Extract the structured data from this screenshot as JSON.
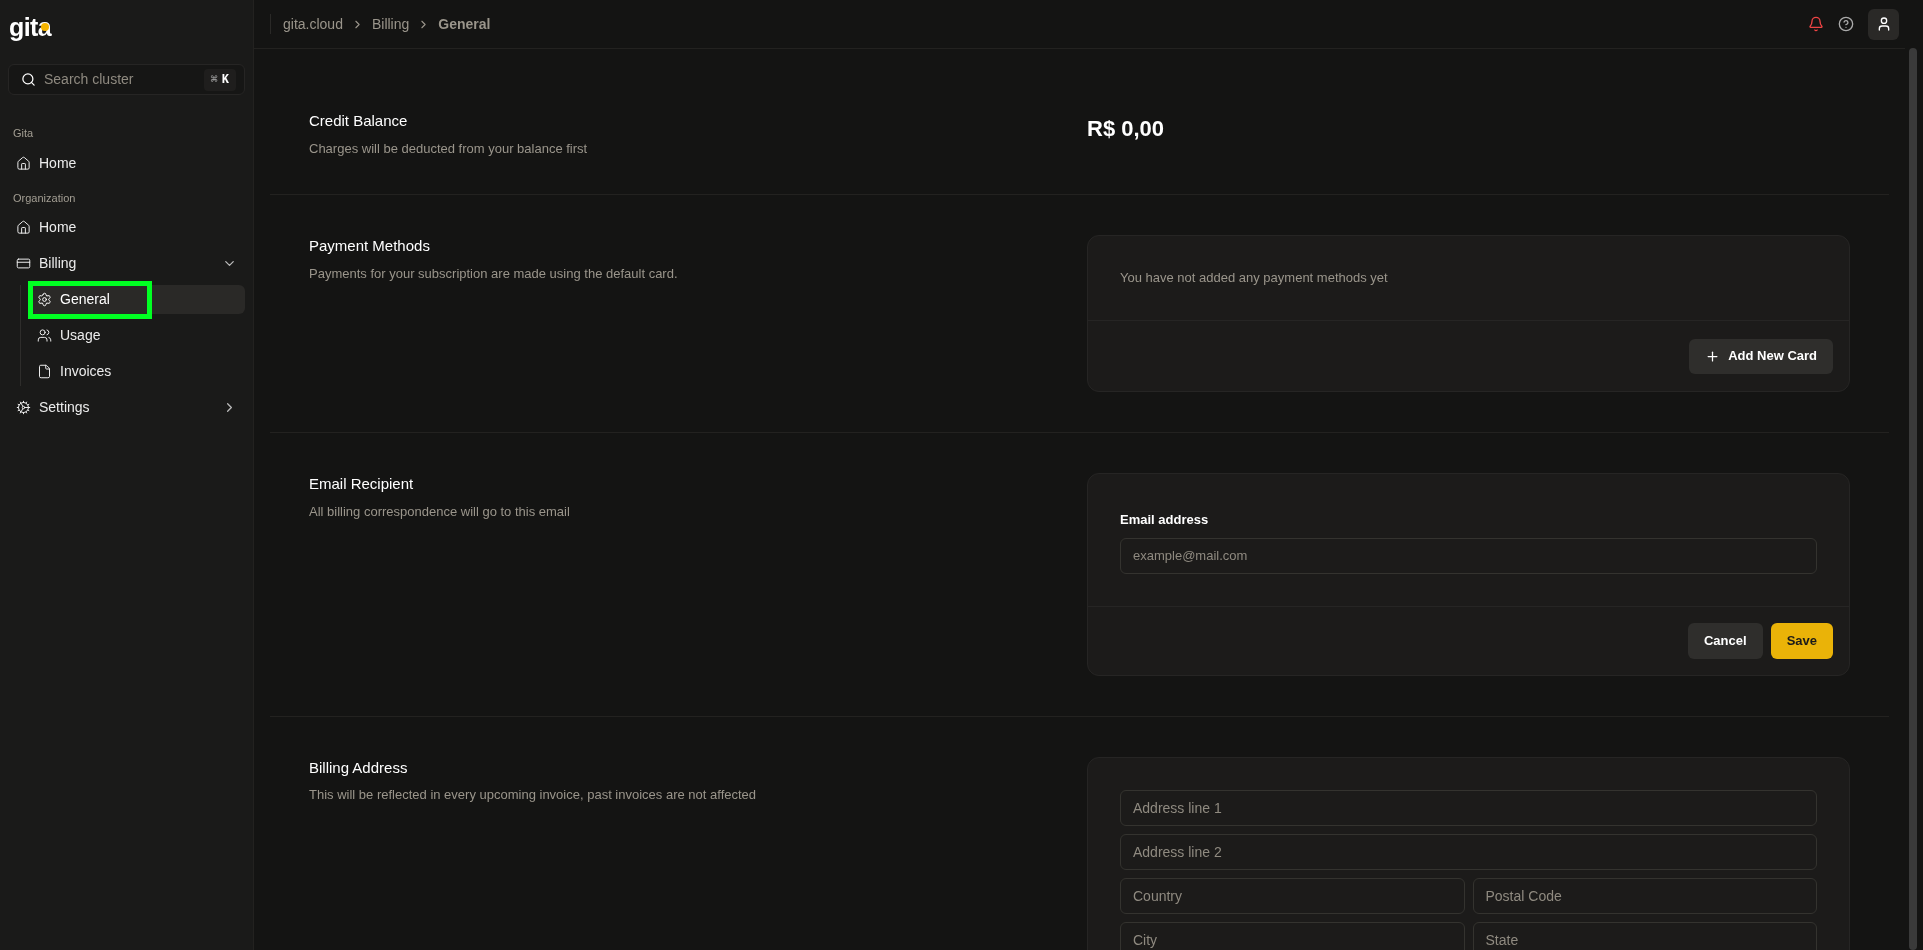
{
  "sidebar": {
    "logo": "gita",
    "search": {
      "placeholder": "Search cluster",
      "shortcut_symbol": "⌘",
      "shortcut_key": "K"
    },
    "groups": [
      {
        "label": "Gita",
        "items": [
          {
            "label": "Home",
            "selected": false
          }
        ]
      },
      {
        "label": "Organization",
        "items": [
          {
            "label": "Home",
            "selected": false
          },
          {
            "label": "Billing",
            "selected": false,
            "expanded": true,
            "children": [
              {
                "label": "General",
                "selected": true
              },
              {
                "label": "Usage",
                "selected": false
              },
              {
                "label": "Invoices",
                "selected": false
              }
            ]
          },
          {
            "label": "Settings",
            "selected": false,
            "expanded": false
          }
        ]
      }
    ]
  },
  "breadcrumb": [
    "gita.cloud",
    "Billing",
    "General"
  ],
  "topbar": {
    "has_notifications": true
  },
  "sections": [
    {
      "kind": "balance",
      "title": "Credit Balance",
      "description": "Charges will be deducted from your balance first",
      "amount": "R$ 0,00"
    },
    {
      "kind": "card_list",
      "title": "Payment Methods",
      "description": "Payments for your subscription are made using the default card.",
      "empty_text": "You have not added any payment methods yet",
      "button": "Add New Card"
    },
    {
      "kind": "email_form",
      "title": "Email Recipient",
      "description": "All billing correspondence will go to this email",
      "field_label": "Email address",
      "placeholder": "example@mail.com",
      "buttons": [
        {
          "label": "Cancel",
          "kind": "secondary"
        },
        {
          "label": "Save",
          "kind": "primary"
        }
      ]
    },
    {
      "kind": "address_form",
      "title": "Billing Address",
      "description": "This will be reflected in every upcoming invoice, past invoices are not affected",
      "rows": [
        [
          {
            "placeholder": "Address line 1"
          }
        ],
        [
          {
            "placeholder": "Address line 2"
          }
        ],
        [
          {
            "placeholder": "Country"
          },
          {
            "placeholder": "Postal Code"
          }
        ],
        [
          {
            "placeholder": "City"
          },
          {
            "placeholder": "State"
          }
        ]
      ]
    }
  ]
}
